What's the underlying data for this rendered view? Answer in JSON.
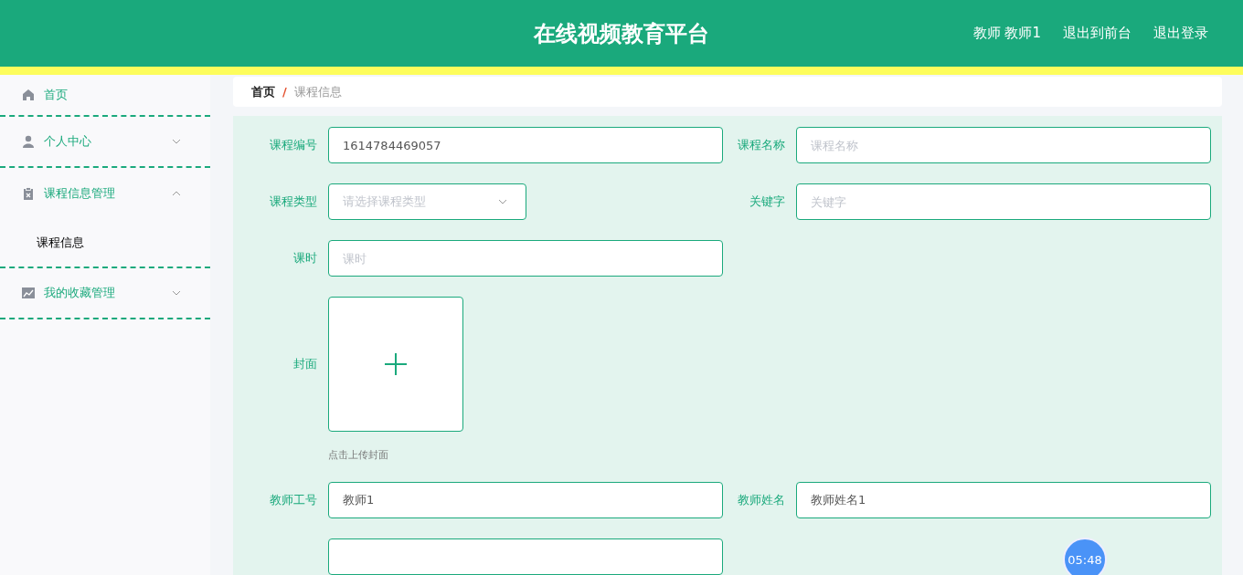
{
  "header": {
    "title": "在线视频教育平台",
    "links": [
      "教师 教师1",
      "退出到前台",
      "退出登录"
    ]
  },
  "sidebar": {
    "items": [
      {
        "label": "首页"
      },
      {
        "label": "个人中心",
        "expanded": false
      },
      {
        "label": "课程信息管理",
        "expanded": true,
        "children": [
          {
            "label": "课程信息",
            "selected": true
          }
        ]
      },
      {
        "label": "我的收藏管理",
        "expanded": false
      }
    ]
  },
  "breadcrumb": {
    "items": [
      "首页",
      "课程信息"
    ],
    "separator": "/"
  },
  "form": {
    "rows": [
      [
        {
          "kind": "text",
          "label": "课程编号",
          "value": "1614784469057"
        },
        {
          "kind": "text",
          "label": "课程名称",
          "placeholder": "课程名称"
        }
      ],
      [
        {
          "kind": "select",
          "label": "课程类型",
          "placeholder": "请选择课程类型"
        },
        {
          "kind": "text",
          "label": "关键字",
          "placeholder": "关键字"
        }
      ],
      [
        {
          "kind": "text",
          "label": "课时",
          "placeholder": "课时"
        }
      ],
      [
        {
          "kind": "upload",
          "label": "封面",
          "hint": "点击上传封面"
        }
      ],
      [
        {
          "kind": "text",
          "label": "教师工号",
          "value": "教师1"
        },
        {
          "kind": "text",
          "label": "教师姓名",
          "value": "教师姓名1"
        }
      ],
      [
        {
          "kind": "text"
        }
      ]
    ]
  },
  "timer": "05:48"
}
